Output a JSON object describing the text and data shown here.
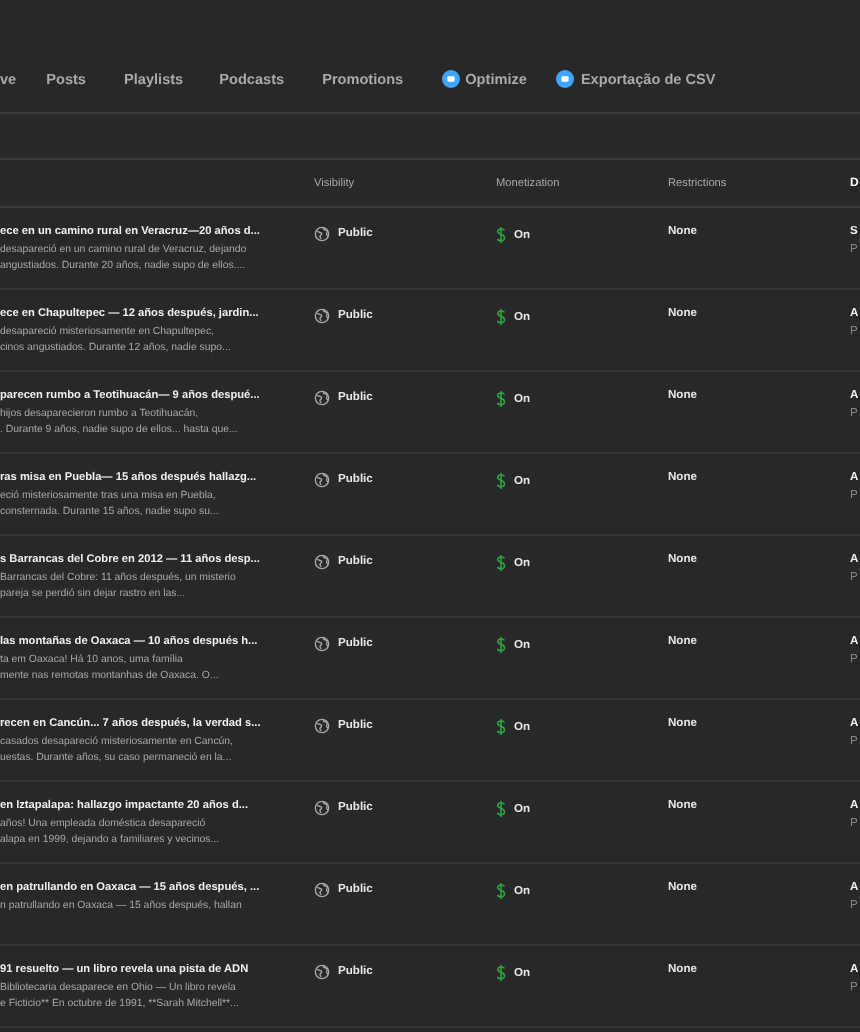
{
  "tabs": [
    {
      "label": "ve",
      "selected": false,
      "icon": false
    },
    {
      "label": "Posts",
      "selected": false,
      "icon": false
    },
    {
      "label": "Playlists",
      "selected": false,
      "icon": false
    },
    {
      "label": "Podcasts",
      "selected": false,
      "icon": false
    },
    {
      "label": "Promotions",
      "selected": false,
      "icon": false
    },
    {
      "label": "Optimize",
      "selected": false,
      "icon": true
    },
    {
      "label": "Exportação de CSV",
      "selected": false,
      "icon": true
    }
  ],
  "table": {
    "columns": [
      "Visibility",
      "Monetization",
      "Restrictions",
      "D"
    ],
    "rows": [
      {
        "title": "ece en un camino rural en Veracruz—20 años d...",
        "description": [
          "desapareció en un camino rural de Veracruz, dejando",
          "angustiados. Durante 20 años, nadie supo de ellos...."
        ],
        "visibility": "Public",
        "monetization": "On",
        "restrictions": "None",
        "date": [
          "S",
          "P"
        ]
      },
      {
        "title": "ece en Chapultepec — 12 años después, jardin...",
        "description": [
          "desapareció misteriosamente en Chapultepec,",
          "cinos angustiados. Durante 12 años, nadie supo..."
        ],
        "visibility": "Public",
        "monetization": "On",
        "restrictions": "None",
        "date": [
          "A",
          "P"
        ]
      },
      {
        "title": "parecen rumbo a Teotihuacán— 9 años despué...",
        "description": [
          "hijos desaparecieron rumbo a Teotihuacán,",
          ". Durante 9 años, nadie supo de ellos... hasta que..."
        ],
        "visibility": "Public",
        "monetization": "On",
        "restrictions": "None",
        "date": [
          "A",
          "P"
        ]
      },
      {
        "title": "ras misa en Puebla— 15 años después hallazg...",
        "description": [
          "eció misteriosamente tras una misa en Puebla,",
          "consternada. Durante 15 años, nadie supo su..."
        ],
        "visibility": "Public",
        "monetization": "On",
        "restrictions": "None",
        "date": [
          "A",
          "P"
        ]
      },
      {
        "title": "s Barrancas del Cobre en 2012 — 11 años desp...",
        "description": [
          "Barrancas del Cobre: 11 años después, un misterio",
          "pareja se perdió sin dejar rastro en las..."
        ],
        "visibility": "Public",
        "monetization": "On",
        "restrictions": "None",
        "date": [
          "A",
          "P"
        ]
      },
      {
        "title": "las montañas de Oaxaca — 10 años después h...",
        "description": [
          "ta em Oaxaca! Há 10 anos, uma família",
          "mente nas remotas montanhas de Oaxaca. O..."
        ],
        "visibility": "Public",
        "monetization": "On",
        "restrictions": "None",
        "date": [
          "A",
          "P"
        ]
      },
      {
        "title": "recen en Cancún... 7 años después, la verdad s...",
        "description": [
          "casados desapareció misteriosamente en Cancún,",
          "uestas. Durante años, su caso permaneció en la..."
        ],
        "visibility": "Public",
        "monetization": "On",
        "restrictions": "None",
        "date": [
          "A",
          "P"
        ]
      },
      {
        "title": "en Iztapalapa: hallazgo impactante 20 años d...",
        "description": [
          "años! Una empleada doméstica desapareció",
          "alapa en 1999, dejando a familiares y vecinos..."
        ],
        "visibility": "Public",
        "monetization": "On",
        "restrictions": "None",
        "date": [
          "A",
          "P"
        ]
      },
      {
        "title": "en patrullando en Oaxaca — 15 años después, ...",
        "description": [
          "n patrullando en Oaxaca — 15 años después, hallan"
        ],
        "visibility": "Public",
        "monetization": "On",
        "restrictions": "None",
        "date": [
          "A",
          "P"
        ]
      },
      {
        "title": "91 resuelto — un libro revela una pista de ADN",
        "description": [
          "Bibliotecaria desaparece en Ohio — Un libro revela",
          "e Ficticio** En octubre de 1991, **Sarah Mitchell**..."
        ],
        "visibility": "Public",
        "monetization": "On",
        "restrictions": "None",
        "date": [
          "A",
          "P"
        ]
      }
    ]
  }
}
